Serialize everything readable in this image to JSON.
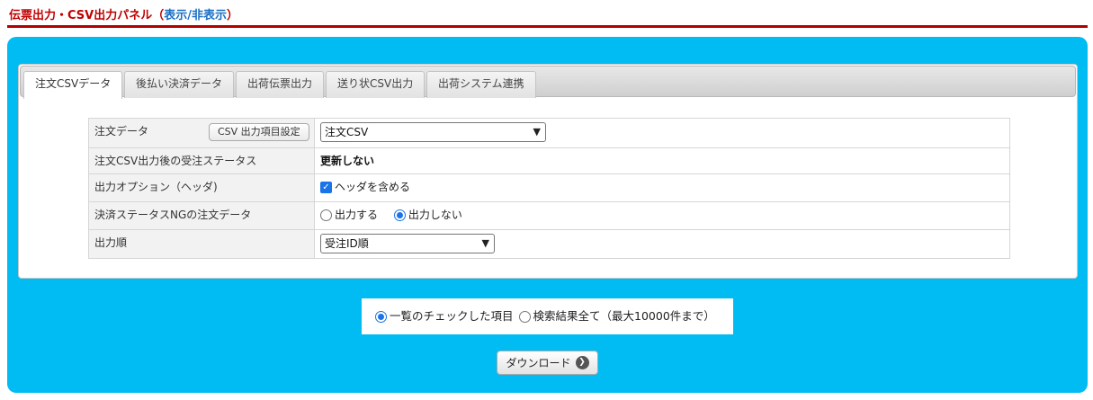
{
  "header": {
    "title": "伝票出力・CSV出力パネル",
    "toggle_open": "（",
    "toggle_label": "表示/非表示",
    "toggle_close": "）"
  },
  "tabs": [
    {
      "label": "注文CSVデータ",
      "active": true
    },
    {
      "label": "後払い決済データ"
    },
    {
      "label": "出荷伝票出力"
    },
    {
      "label": "送り状CSV出力"
    },
    {
      "label": "出荷システム連携"
    }
  ],
  "form": {
    "order_data": {
      "label": "注文データ",
      "settings_button": "CSV 出力項目設定",
      "select_value": "注文CSV"
    },
    "status_after_output": {
      "label": "注文CSV出力後の受注ステータス",
      "value": "更新しない"
    },
    "output_option": {
      "label": "出力オプション（ヘッダ)",
      "checkbox_label": "ヘッダを含める",
      "checked": true
    },
    "payment_ng": {
      "label": "決済ステータスNGの注文データ",
      "option_output": "出力する",
      "option_no_output": "出力しない",
      "selected": "出力しない"
    },
    "output_order": {
      "label": "出力順",
      "select_value": "受注ID順"
    }
  },
  "scope": {
    "option_checked_items": "一覧のチェックした項目",
    "option_all_results": "検索結果全て（最大10000件まで）",
    "selected": "一覧のチェックした項目"
  },
  "download_button": {
    "label": "ダウンロード",
    "icon": "arrow-right-circle-icon"
  },
  "colors": {
    "header_red": "#c00000",
    "panel_blue": "#00bcf2",
    "link_blue": "#1a6fc4"
  }
}
